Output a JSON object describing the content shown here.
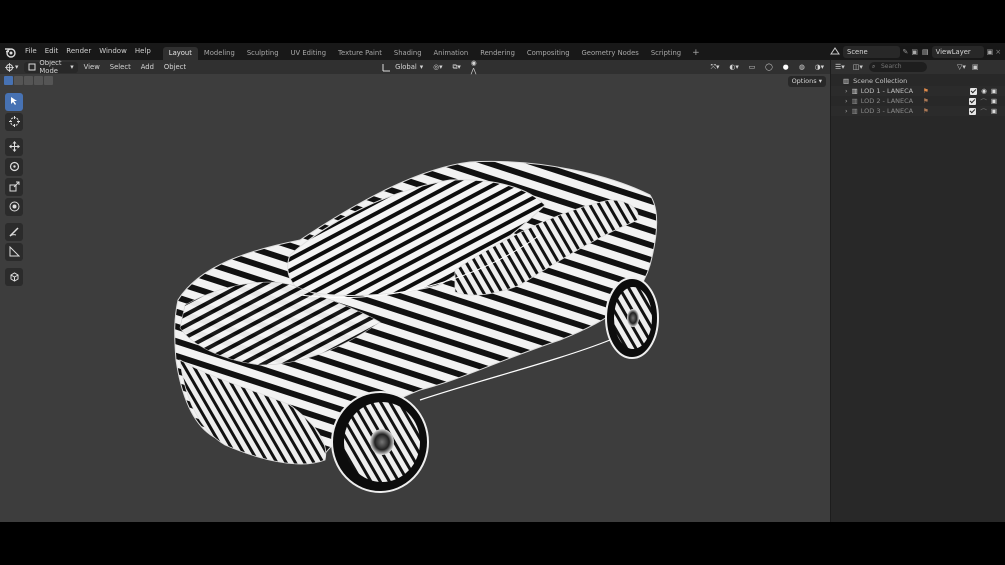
{
  "menu": [
    "File",
    "Edit",
    "Render",
    "Window",
    "Help"
  ],
  "workspaces": {
    "tabs": [
      "Layout",
      "Modeling",
      "Sculpting",
      "UV Editing",
      "Texture Paint",
      "Shading",
      "Animation",
      "Rendering",
      "Compositing",
      "Geometry Nodes",
      "Scripting"
    ],
    "active": "Layout",
    "add_label": "+"
  },
  "scene": {
    "name": "Scene"
  },
  "view_layer": {
    "name": "ViewLayer"
  },
  "viewport_header": {
    "mode": "Object Mode",
    "menus": [
      "View",
      "Select",
      "Add",
      "Object"
    ],
    "orientation": "Global",
    "options_label": "Options"
  },
  "outliner": {
    "search_placeholder": "Search",
    "root": "Scene Collection",
    "items": [
      {
        "name": "LOD 1 - LANECA"
      },
      {
        "name": "LOD 2 - LANECA"
      },
      {
        "name": "LOD 3 - LANECA"
      }
    ]
  },
  "colors": {
    "accent": "#4772b3",
    "viewport_bg": "#3d3d3d",
    "header_bg": "#303030"
  },
  "icons": [
    "blender-logo-icon",
    "select-box-icon",
    "cursor-icon",
    "move-icon",
    "rotate-icon",
    "scale-icon",
    "transform-icon",
    "annotate-icon",
    "measure-icon",
    "add-cube-icon"
  ]
}
